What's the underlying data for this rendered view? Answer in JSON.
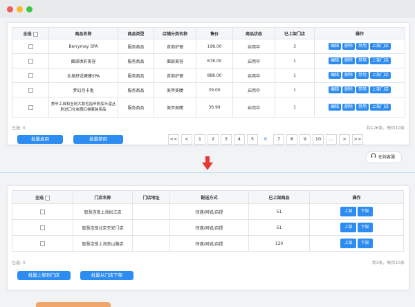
{
  "window": {
    "dots": [
      "#f45b5b",
      "#f9b82f",
      "#3ec548"
    ]
  },
  "colors": {
    "accent": "#2d8cf0",
    "arrow": "#e53935"
  },
  "product_table": {
    "headers": [
      "全选",
      "商品名称",
      "商品类型",
      "店铺分类名称",
      "售价",
      "商品状态",
      "已上架门店",
      "操作"
    ],
    "rows": [
      {
        "name": "Berrymay SPA",
        "type": "服务商品",
        "category": "背部护理",
        "price": "198.00",
        "status": "启用中",
        "stores": "3"
      },
      {
        "name": "面部焕彩美容",
        "type": "服务商品",
        "category": "面部美容",
        "price": "678.00",
        "status": "启用中",
        "stores": "1"
      },
      {
        "name": "全身舒适健康SPA",
        "type": "服务商品",
        "category": "背部护理",
        "price": "888.00",
        "status": "启用中",
        "stores": "1"
      },
      {
        "name": "梦幻月卡鬼",
        "type": "服务商品",
        "category": "美甲美睫",
        "price": "39.00",
        "status": "启用中",
        "stores": "1"
      },
      {
        "name": "美甲工具和全网大款毛指甲刷底头溜丛刷进口化妆删红梯套装用品",
        "type": "服务商品",
        "category": "美甲美睫",
        "price": "36.99",
        "status": "启用中",
        "stores": "1"
      }
    ],
    "actions": [
      "编辑",
      "删除",
      "禁用",
      "上架门店"
    ]
  },
  "product_footer": {
    "selected": "已选: 0",
    "summary": "共126条，每页10条",
    "batch_enable": "批量启用",
    "batch_disable": "批量禁用"
  },
  "pagination": {
    "items": [
      "<<",
      "<",
      "1",
      "2",
      "3",
      "4",
      "5",
      "6",
      "7",
      "8",
      "9",
      "10",
      "...",
      ">",
      ">>"
    ],
    "current": "6"
  },
  "online_service": {
    "label": "在线客服"
  },
  "store_table": {
    "headers": [
      "全选",
      "门店名称",
      "门店地址",
      "配送方式",
      "已上架商品",
      "操作"
    ],
    "rows": [
      {
        "name": "智慧连锁上海松江店",
        "address": "",
        "delivery": "快递/同城/自提",
        "count": "51"
      },
      {
        "name": "智慧连锁北京天安门店",
        "address": "",
        "delivery": "快递/同城/自提",
        "count": "51"
      },
      {
        "name": "智慧连锁上海宫山路店",
        "address": "",
        "delivery": "快递/同城/自提",
        "count": "120"
      }
    ],
    "actions": [
      "上架",
      "下架"
    ]
  },
  "store_footer": {
    "selected": "已选: 0",
    "summary": "共3条，每页10条",
    "batch_up": "批量上架到门店",
    "batch_down": "批量从门店下架"
  }
}
